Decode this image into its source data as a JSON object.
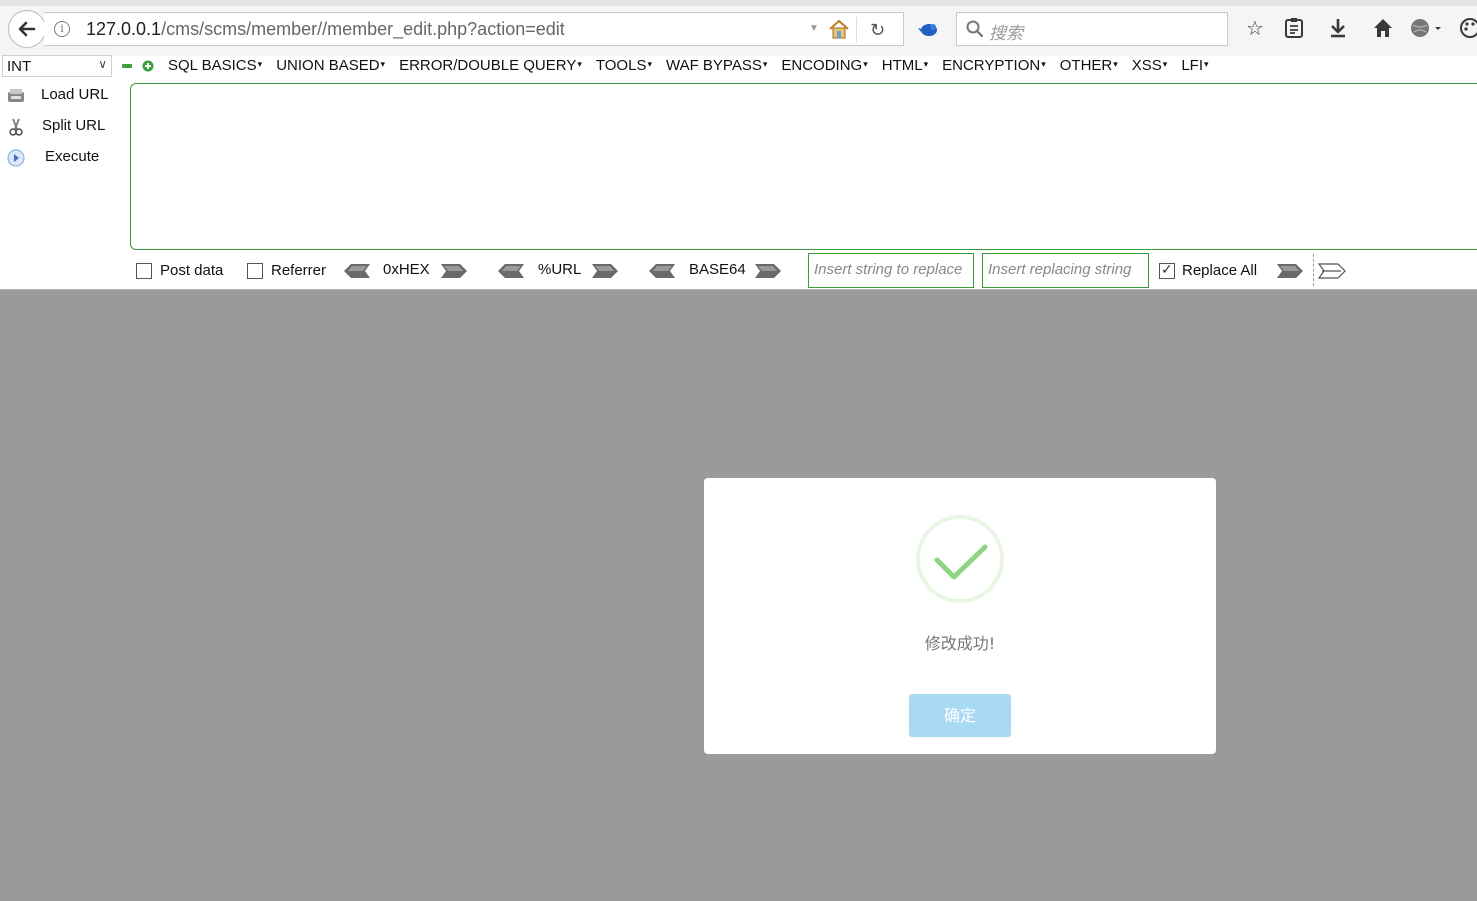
{
  "browser": {
    "url_host": "127.0.0.1",
    "url_path": "/cms/scms/member//member_edit.php?action=edit",
    "search_placeholder": "搜索"
  },
  "hackbar": {
    "type_select_value": "INT",
    "menu": [
      "SQL BASICS",
      "UNION BASED",
      "ERROR/DOUBLE QUERY",
      "TOOLS",
      "WAF BYPASS",
      "ENCODING",
      "HTML",
      "ENCRYPTION",
      "OTHER",
      "XSS",
      "LFI"
    ],
    "actions": {
      "load_url": "Load URL",
      "split_url": "Split URL",
      "execute": "Execute"
    },
    "textarea_value": "",
    "options": {
      "post_data": "Post data",
      "referrer": "Referrer",
      "hex": "0xHEX",
      "url_enc": "%URL",
      "base64": "BASE64",
      "replace_find_placeholder": "Insert string to replace",
      "replace_with_placeholder": "Insert replacing string",
      "replace_all": "Replace All"
    }
  },
  "modal": {
    "message": "修改成功!",
    "ok_label": "确定"
  },
  "colors": {
    "hackbar_accent": "#3a9a3a",
    "success_green": "#8ed582",
    "ok_button": "#a8daf3",
    "overlay": "#9a9a9a"
  }
}
